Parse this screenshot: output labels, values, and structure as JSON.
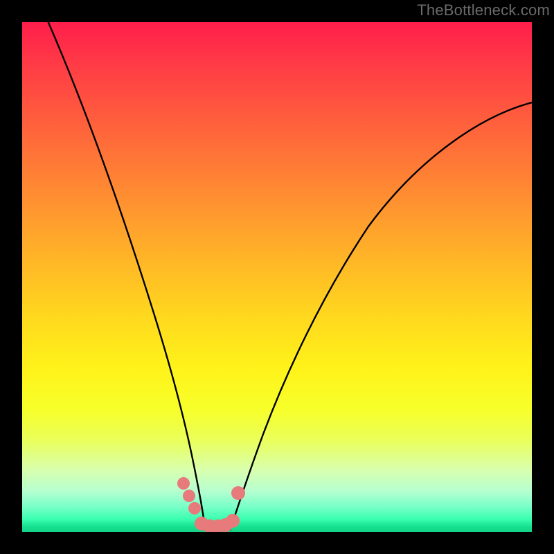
{
  "watermark": {
    "text": "TheBottleneck.com"
  },
  "chart_data": {
    "type": "line",
    "title": "",
    "xlabel": "",
    "ylabel": "",
    "xlim": [
      0,
      100
    ],
    "ylim": [
      0,
      100
    ],
    "background_gradient": {
      "top": "#ff1e4b",
      "mid": "#fff31a",
      "bottom": "#14d488"
    },
    "series": [
      {
        "name": "curve-left",
        "stroke": "#000000",
        "x": [
          4,
          8,
          12,
          16,
          20,
          24,
          27,
          29,
          31,
          33,
          34,
          35
        ],
        "values": [
          100,
          88,
          74,
          61,
          48,
          35,
          22,
          15,
          9,
          4,
          2,
          0
        ]
      },
      {
        "name": "curve-right",
        "stroke": "#000000",
        "x": [
          41,
          43,
          46,
          50,
          55,
          62,
          70,
          80,
          90,
          100
        ],
        "values": [
          0,
          4,
          12,
          22,
          34,
          48,
          60,
          70,
          78,
          82
        ]
      },
      {
        "name": "markers",
        "stroke": "#e77a7a",
        "type_override": "scatter",
        "x": [
          31.5,
          32.5,
          33.5,
          35.0,
          36.5,
          38.0,
          39.5,
          41.0,
          42.0
        ],
        "values": [
          9.5,
          7.0,
          4.5,
          1.0,
          0.5,
          0.5,
          0.7,
          1.5,
          7.5
        ]
      }
    ],
    "grid": false,
    "legend": false
  }
}
